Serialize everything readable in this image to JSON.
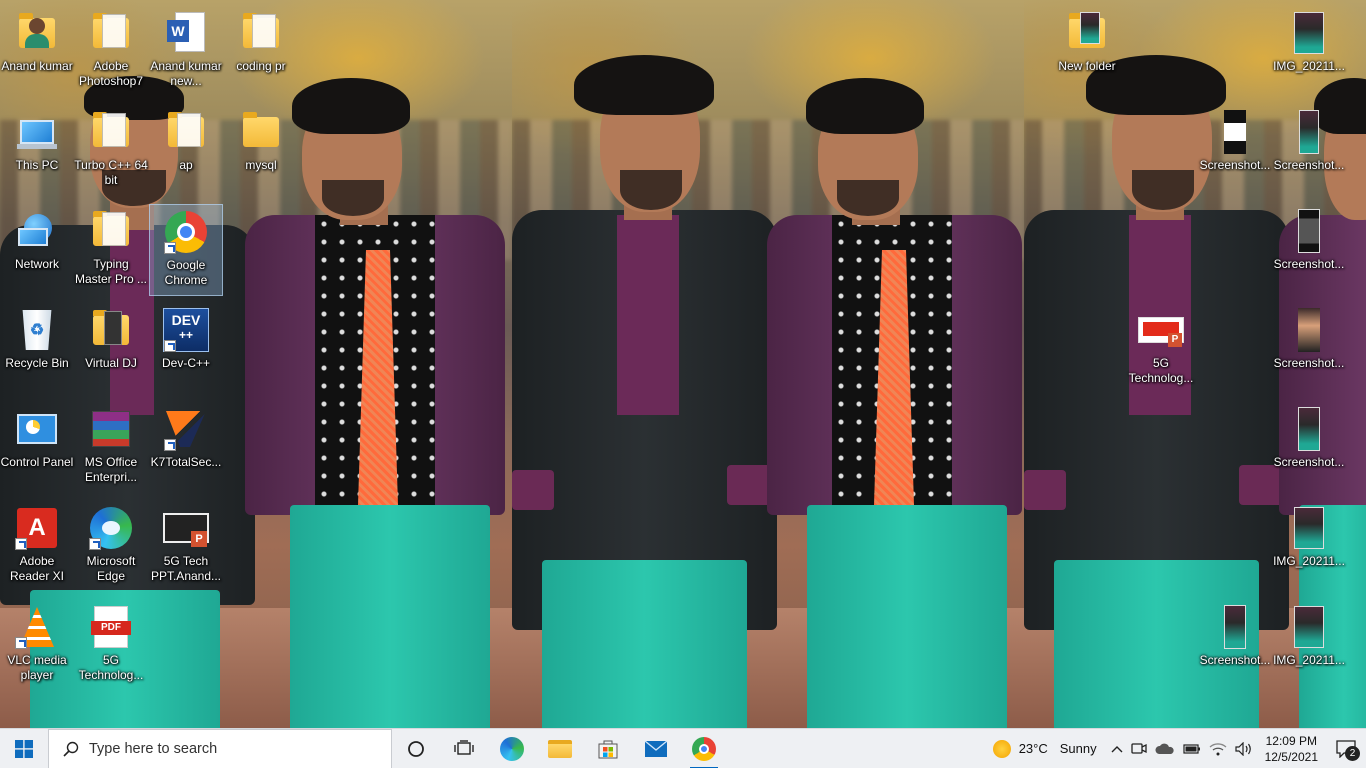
{
  "desktop": {
    "icons": [
      {
        "label": "Anand kumar",
        "icon": "user-folder-icon"
      },
      {
        "label": "Adobe Photoshop7",
        "icon": "folder-icon"
      },
      {
        "label": "Anand kumar new...",
        "icon": "word-document-icon"
      },
      {
        "label": "coding pr",
        "icon": "folder-icon"
      },
      {
        "label": "This PC",
        "icon": "this-pc-icon"
      },
      {
        "label": "Turbo C++ 64 bit",
        "icon": "folder-icon"
      },
      {
        "label": "ap",
        "icon": "folder-icon"
      },
      {
        "label": "mysql",
        "icon": "folder-icon"
      },
      {
        "label": "Network",
        "icon": "network-icon"
      },
      {
        "label": "Typing Master Pro ...",
        "icon": "folder-icon"
      },
      {
        "label": "Google Chrome",
        "icon": "chrome-icon"
      },
      {
        "label": "Recycle Bin",
        "icon": "recycle-bin-icon"
      },
      {
        "label": "Virtual DJ",
        "icon": "folder-icon"
      },
      {
        "label": "Dev-C++",
        "icon": "devcpp-icon",
        "badge": "DEV"
      },
      {
        "label": "Control Panel",
        "icon": "control-panel-icon"
      },
      {
        "label": "MS Office Enterpri...",
        "icon": "winrar-archive-icon"
      },
      {
        "label": "K7TotalSec...",
        "icon": "k7-icon"
      },
      {
        "label": "Adobe Reader XI",
        "icon": "adobe-reader-icon"
      },
      {
        "label": "Microsoft Edge",
        "icon": "edge-icon"
      },
      {
        "label": "5G Tech PPT.Anand...",
        "icon": "powerpoint-icon"
      },
      {
        "label": "VLC media player",
        "icon": "vlc-icon"
      },
      {
        "label": "5G Technolog...",
        "icon": "pdf-icon",
        "badge": "PDF"
      },
      {
        "label": "New folder",
        "icon": "photo-folder-icon"
      },
      {
        "label": "IMG_20211...",
        "icon": "photo-thumbnail-icon"
      },
      {
        "label": "Screenshot...",
        "icon": "screenshot-thumbnail-icon"
      },
      {
        "label": "Screenshot...",
        "icon": "screenshot-thumbnail-icon"
      },
      {
        "label": "Screenshot...",
        "icon": "screenshot-thumbnail-icon"
      },
      {
        "label": "5G Technolog...",
        "icon": "powerpoint-icon"
      },
      {
        "label": "Screenshot...",
        "icon": "screenshot-thumbnail-icon"
      },
      {
        "label": "Screenshot...",
        "icon": "screenshot-thumbnail-icon"
      },
      {
        "label": "IMG_20211...",
        "icon": "photo-thumbnail-icon"
      },
      {
        "label": "Screenshot...",
        "icon": "screenshot-thumbnail-icon"
      },
      {
        "label": "IMG_20211...",
        "icon": "photo-thumbnail-icon"
      }
    ]
  },
  "taskbar": {
    "search_placeholder": "Type here to search",
    "apps": [
      "task-view-icon",
      "edge-icon",
      "file-explorer-icon",
      "microsoft-store-icon",
      "mail-icon",
      "chrome-icon"
    ],
    "weather": {
      "temp": "23°C",
      "condition": "Sunny"
    },
    "clock": {
      "time": "12:09 PM",
      "date": "12/5/2021"
    },
    "notifications": {
      "count": "2"
    }
  },
  "colors": {
    "accent": "#0067c0",
    "taskbar_bg": "#eef0f3",
    "pants": "#2cc7ad",
    "tie": "#ff6a3c"
  }
}
